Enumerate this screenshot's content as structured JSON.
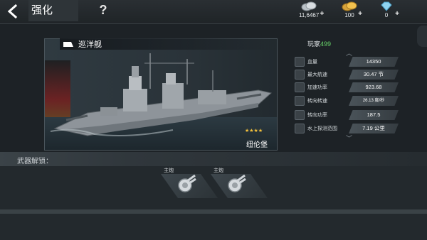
{
  "header": {
    "title": "强化",
    "help": "?",
    "currencies": [
      {
        "icon": "silver-coin-icon",
        "amount": "11,6467"
      },
      {
        "icon": "gold-coin-icon",
        "amount": "100"
      },
      {
        "icon": "diamond-icon",
        "amount": "0"
      }
    ],
    "plus": "+"
  },
  "ship": {
    "class": "巡洋舰",
    "stars": "★★★★",
    "name": "纽伦堡"
  },
  "stats": {
    "player_prefix": "玩家",
    "player_level": "499",
    "rows": [
      {
        "label": "血量",
        "value": "14350"
      },
      {
        "label": "最大航速",
        "value": "30.47 节"
      },
      {
        "label": "加速功率",
        "value": "923.68"
      },
      {
        "label": "转向转速",
        "value": "26.13 度/秒"
      },
      {
        "label": "转向功率",
        "value": "187.5"
      },
      {
        "label": "水上探测范围",
        "value": "7.19 公里"
      }
    ],
    "scroll_up": "︿",
    "scroll_down": "﹀"
  },
  "weapons": {
    "header": "武器解锁：",
    "items": [
      {
        "label": "主炮"
      },
      {
        "label": "主炮"
      }
    ]
  },
  "colors": {
    "accent_green": "#67d36a",
    "star_gold": "#f5c23c",
    "background": "#1d2226"
  }
}
